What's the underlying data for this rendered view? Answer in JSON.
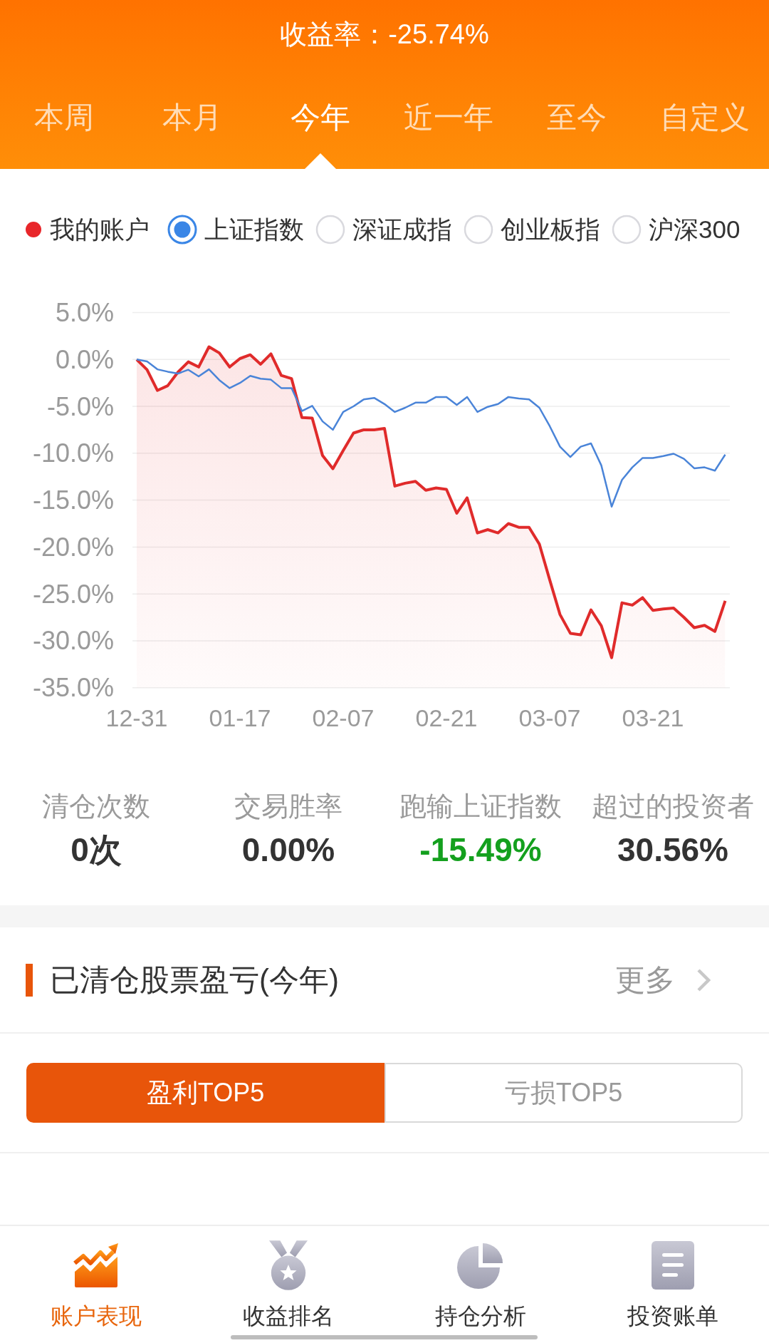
{
  "header": {
    "title": "收益率：-25.74%"
  },
  "tabs": [
    {
      "label": "本周",
      "selected": false
    },
    {
      "label": "本月",
      "selected": false
    },
    {
      "label": "今年",
      "selected": true
    },
    {
      "label": "近一年",
      "selected": false
    },
    {
      "label": "至今",
      "selected": false
    },
    {
      "label": "自定义",
      "selected": false
    }
  ],
  "legend": {
    "account": {
      "label": "我的账户",
      "color": "#e8262a"
    },
    "benchmarks": [
      {
        "label": "上证指数",
        "selected": true
      },
      {
        "label": "深证成指",
        "selected": false
      },
      {
        "label": "创业板指",
        "selected": false
      },
      {
        "label": "沪深300",
        "selected": false
      }
    ]
  },
  "chart": {
    "chart_data": {
      "type": "line",
      "grid": true,
      "categories": [
        "12-31",
        null,
        null,
        null,
        null,
        null,
        null,
        null,
        null,
        null,
        "01-17",
        null,
        null,
        null,
        null,
        null,
        null,
        null,
        null,
        null,
        "02-07",
        null,
        null,
        null,
        null,
        null,
        null,
        null,
        null,
        null,
        "02-21",
        null,
        null,
        null,
        null,
        null,
        null,
        null,
        null,
        null,
        "03-07",
        null,
        null,
        null,
        null,
        null,
        null,
        null,
        null,
        null,
        "03-21",
        null,
        null,
        null,
        null,
        null,
        null,
        null
      ],
      "ylim": [
        -35,
        5
      ],
      "yticks": [
        {
          "value": 5,
          "label": "5.0%"
        },
        {
          "value": 0,
          "label": "0.0%"
        },
        {
          "value": -5,
          "label": "-5.0%"
        },
        {
          "value": -10,
          "label": "-10.0%"
        },
        {
          "value": -15,
          "label": "-15.0%"
        },
        {
          "value": -20,
          "label": "-20.0%"
        },
        {
          "value": -25,
          "label": "-25.0%"
        },
        {
          "value": -30,
          "label": "-30.0%"
        },
        {
          "value": -35,
          "label": "-35.0%"
        }
      ],
      "series": [
        {
          "color": "#e02b2b",
          "values": [
            0,
            -1.1,
            -3.3,
            -2.8,
            -1.35,
            -0.25,
            -0.8,
            1.35,
            0.7,
            -0.8,
            0.1,
            0.5,
            -0.5,
            0.6,
            -1.7,
            -2.05,
            -6.2,
            -6.25,
            -10.25,
            -11.65,
            -9.7,
            -7.85,
            -7.5,
            -7.5,
            -7.35,
            -13.5,
            -13.2,
            -13.0,
            -13.95,
            -13.7,
            -13.85,
            -16.4,
            -14.75,
            -18.5,
            -18.15,
            -18.5,
            -17.5,
            -17.9,
            -17.9,
            -19.7,
            -23.5,
            -27.2,
            -29.2,
            -29.35,
            -26.7,
            -28.4,
            -31.8,
            -25.95,
            -26.2,
            -25.4,
            -26.75,
            -26.6,
            -26.5,
            -27.5,
            -28.6,
            -28.35,
            -29.0,
            -25.74
          ]
        },
        {
          "color": "#4a84d8",
          "values": [
            0,
            -0.2,
            -1.05,
            -1.3,
            -1.5,
            -1.1,
            -1.8,
            -1.05,
            -2.2,
            -3.05,
            -2.5,
            -1.75,
            -2.05,
            -2.15,
            -3.05,
            -3.05,
            -5.5,
            -4.95,
            -6.6,
            -7.5,
            -5.6,
            -5.0,
            -4.25,
            -4.1,
            -4.75,
            -5.6,
            -5.15,
            -4.6,
            -4.6,
            -4.0,
            -4.0,
            -4.85,
            -4.0,
            -5.6,
            -5.05,
            -4.75,
            -4.0,
            -4.15,
            -4.25,
            -5.15,
            -7.1,
            -9.3,
            -10.4,
            -9.3,
            -8.95,
            -11.3,
            -15.7,
            -12.85,
            -11.5,
            -10.5,
            -10.5,
            -10.3,
            -10.05,
            -10.6,
            -11.6,
            -11.5,
            -11.85,
            -10.15
          ]
        }
      ]
    }
  },
  "stats": [
    {
      "label": "清仓次数",
      "value": "0次",
      "color": "#333333"
    },
    {
      "label": "交易胜率",
      "value": "0.00%",
      "color": "#333333"
    },
    {
      "label": "跑输上证指数",
      "value": "-15.49%",
      "color": "#14a01e"
    },
    {
      "label": "超过的投资者",
      "value": "30.56%",
      "color": "#333333"
    }
  ],
  "section": {
    "title": "已清仓股票盈亏(今年)",
    "more": "更多"
  },
  "toggle": [
    {
      "label": "盈利TOP5",
      "selected": true
    },
    {
      "label": "亏损TOP5",
      "selected": false
    }
  ],
  "nav": [
    {
      "label": "账户表现",
      "selected": true
    },
    {
      "label": "收益排名",
      "selected": false
    },
    {
      "label": "持仓分析",
      "selected": false
    },
    {
      "label": "投资账单",
      "selected": false
    }
  ]
}
